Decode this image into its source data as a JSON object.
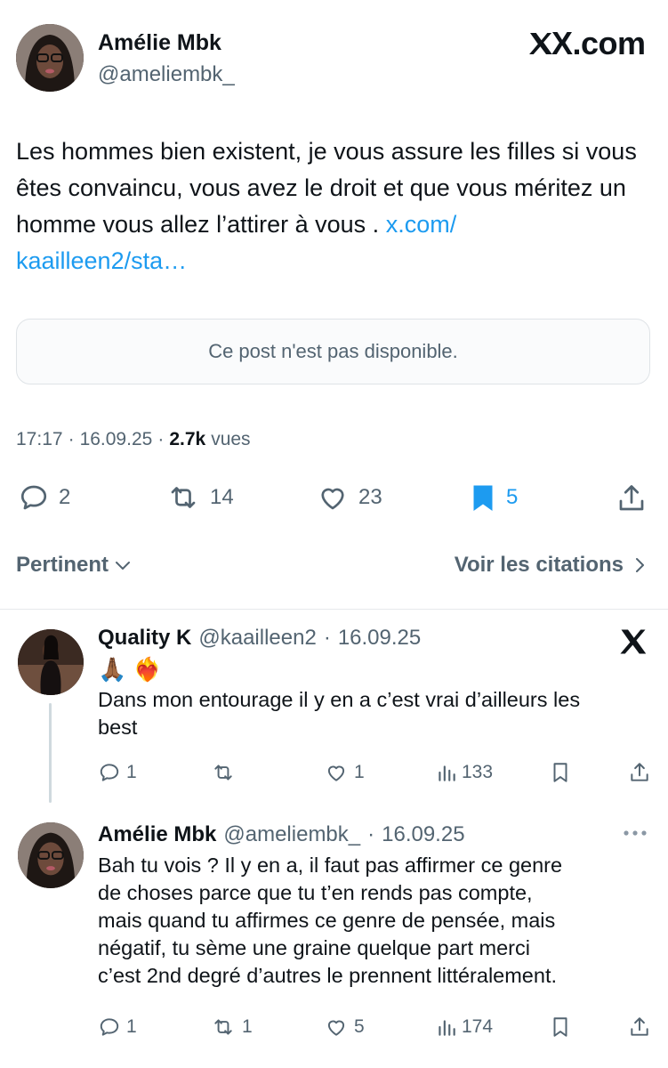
{
  "main_post": {
    "author_name": "Amélie Mbk",
    "author_handle": "@ameliembk_",
    "site_logo": "X.com",
    "text": "Les hommes bien existent, je vous assure les filles si vous êtes convaincu, vous avez le droit et que vous méritez un homme vous allez l’attirer à vous .",
    "link_text_line1": "x.com/",
    "link_text_line2": "kaailleen2/sta…",
    "quoted_card_text": "Ce post n'est pas disponible.",
    "time": "17:17",
    "date": "16.09.25",
    "views_count": "2.7k",
    "views_label": "vues",
    "separator": "·",
    "actions": {
      "replies": "2",
      "reposts": "14",
      "likes": "23",
      "bookmarks": "5"
    }
  },
  "sort_bar": {
    "sort_label": "Pertinent",
    "quotes_label": "Voir les citations"
  },
  "replies": [
    {
      "author_name": "Quality K",
      "author_handle": "@kaailleen2",
      "date": "16.09.25",
      "emoji": "🙏🏾 ❤️‍🔥",
      "text_line1": "Dans mon entourage il y en a c’est vrai d’ailleurs les",
      "text_line2": "best",
      "stats": {
        "replies": "1",
        "reposts": "",
        "likes": "1",
        "views": "133"
      }
    },
    {
      "author_name": "Amélie Mbk",
      "author_handle": "@ameliembk_",
      "date": "16.09.25",
      "lines": [
        "Bah tu vois ? Il y en a, il faut pas affirmer ce genre",
        "de choses parce que tu t’en rends pas compte,",
        "mais quand tu affirmes ce genre de pensée, mais",
        "négatif, tu sème une graine quelque part merci",
        "c’est 2nd degré d’autres le prennent littéralement."
      ],
      "stats": {
        "replies": "1",
        "reposts": "1",
        "likes": "5",
        "views": "174"
      }
    }
  ],
  "colors": {
    "text": "#0f1419",
    "muted": "#536471",
    "link": "#1d9bf0",
    "bookmark_active": "#1d9bf0"
  },
  "icons": [
    "reply-icon",
    "repost-icon",
    "like-icon",
    "bookmark-icon",
    "share-icon",
    "views-icon",
    "x-logo-icon",
    "more-icon",
    "chevron-down-icon",
    "chevron-right-icon"
  ]
}
